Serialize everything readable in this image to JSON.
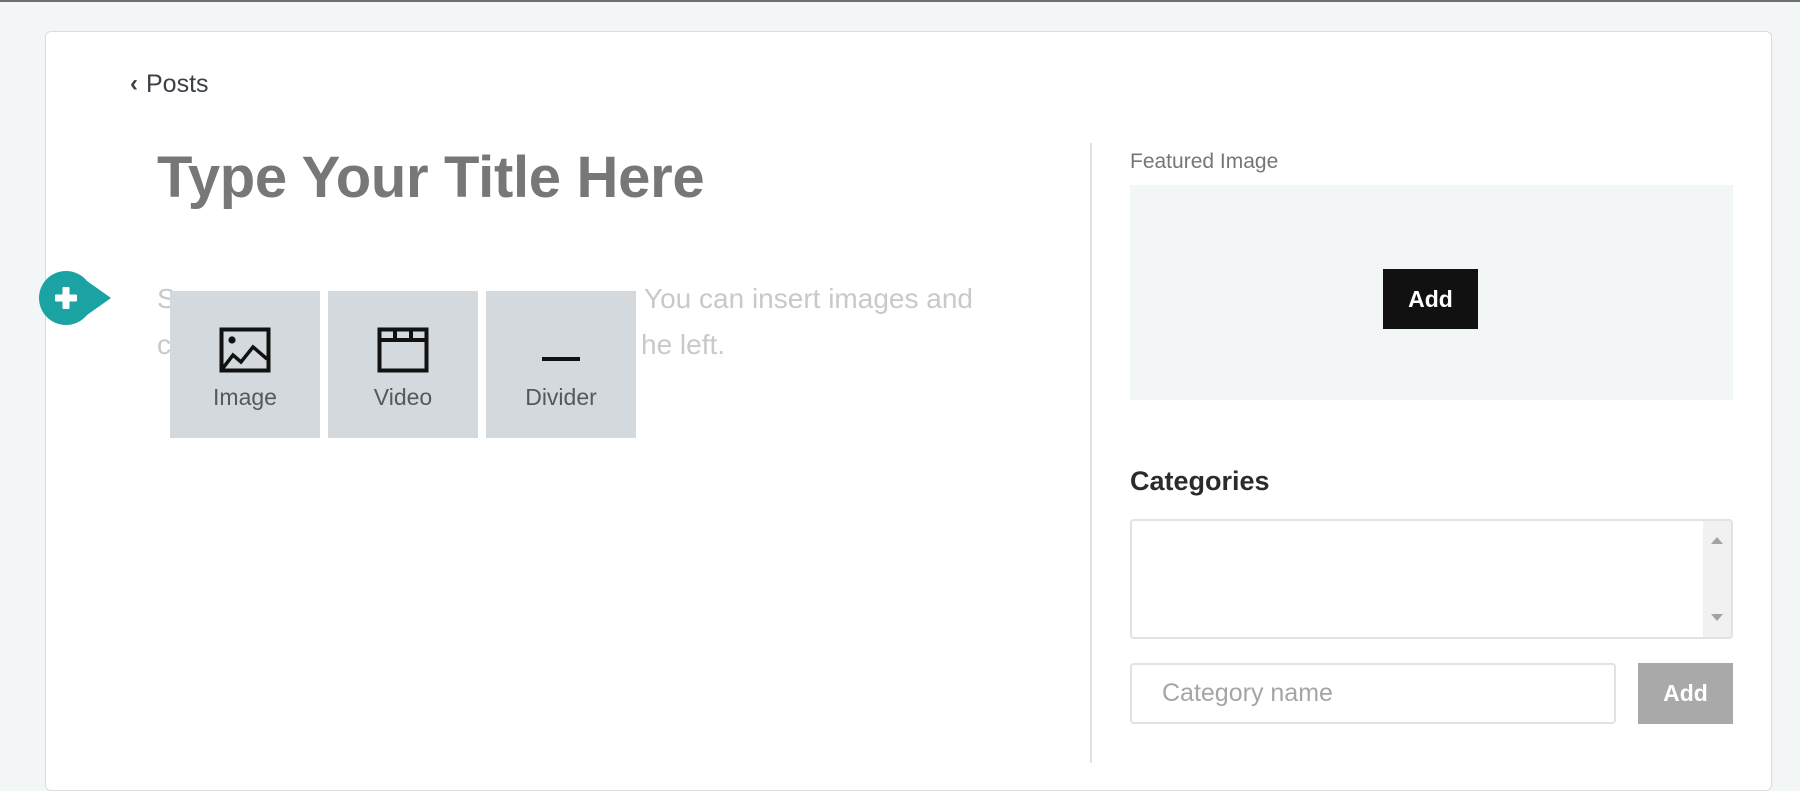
{
  "nav": {
    "back_label": "Posts",
    "back_icon": "chevron-left-icon"
  },
  "editor": {
    "title_placeholder": "Type Your Title Here",
    "body_visible_fragments": {
      "line1_start": "S",
      "line1_end": "You can insert images and",
      "line2_start": "c",
      "line2_end": "he left."
    },
    "inserter": {
      "toggle_icon": "plus-icon",
      "accent_color": "#1ba3a3",
      "items": [
        {
          "label": "Image",
          "icon": "image-icon"
        },
        {
          "label": "Video",
          "icon": "video-icon"
        },
        {
          "label": "Divider",
          "icon": "divider-icon"
        }
      ]
    }
  },
  "sidebar": {
    "featured_image": {
      "label": "Featured Image",
      "add_button": "Add"
    },
    "categories": {
      "heading": "Categories",
      "items": [],
      "input_placeholder": "Category name",
      "input_value": "",
      "add_button": "Add"
    }
  }
}
